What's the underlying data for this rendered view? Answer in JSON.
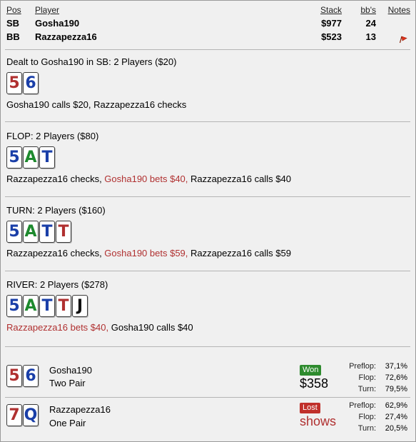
{
  "header": {
    "pos": "Pos",
    "player": "Player",
    "stack": "Stack",
    "bbs": "bb's",
    "notes": "Notes"
  },
  "players": [
    {
      "pos": "SB",
      "name": "Gosha190",
      "stack": "$977",
      "bbs": "24",
      "note_flag": false
    },
    {
      "pos": "BB",
      "name": "Razzapezza16",
      "stack": "$523",
      "bbs": "13",
      "note_flag": true
    }
  ],
  "colors": {
    "hearts_diamonds": "#b03030",
    "clubs": "#1e8a2e",
    "spades": "#111111",
    "blue": "#1a3fa8",
    "highlight": "#b03030",
    "won": "#2e8b2e",
    "lost": "#c0302b"
  },
  "preflop": {
    "title": "Dealt to Gosha190 in SB: 2 Players ($20)",
    "cards": [
      {
        "rank": "5",
        "color": "#b03030"
      },
      {
        "rank": "6",
        "color": "#1a3fa8"
      }
    ],
    "actions_a": "Gosha190 calls $20, Razzapezza16 checks"
  },
  "flop": {
    "title": "FLOP: 2 Players ($80)",
    "cards": [
      {
        "rank": "5",
        "color": "#1a3fa8"
      },
      {
        "rank": "A",
        "color": "#1e8a2e"
      },
      {
        "rank": "T",
        "color": "#1a3fa8"
      }
    ],
    "actions_a": "Razzapezza16 checks, ",
    "actions_b": "Gosha190 bets $40,",
    "actions_c": " Razzapezza16 calls $40"
  },
  "turn": {
    "title": "TURN: 2 Players ($160)",
    "cards": [
      {
        "rank": "5",
        "color": "#1a3fa8"
      },
      {
        "rank": "A",
        "color": "#1e8a2e"
      },
      {
        "rank": "T",
        "color": "#1a3fa8"
      },
      {
        "rank": "T",
        "color": "#b03030"
      }
    ],
    "actions_a": "Razzapezza16 checks, ",
    "actions_b": "Gosha190 bets $59,",
    "actions_c": " Razzapezza16 calls $59"
  },
  "river": {
    "title": "RIVER: 2 Players ($278)",
    "cards": [
      {
        "rank": "5",
        "color": "#1a3fa8"
      },
      {
        "rank": "A",
        "color": "#1e8a2e"
      },
      {
        "rank": "T",
        "color": "#1a3fa8"
      },
      {
        "rank": "T",
        "color": "#b03030"
      },
      {
        "rank": "J",
        "color": "#111111"
      }
    ],
    "actions_a": "Razzapezza16 bets $40,",
    "actions_b": " Gosha190 calls $40"
  },
  "results": [
    {
      "cards": [
        {
          "rank": "5",
          "color": "#b03030"
        },
        {
          "rank": "6",
          "color": "#1a3fa8"
        }
      ],
      "name": "Gosha190",
      "hand": "Two Pair",
      "badge": "Won",
      "amount": "$358",
      "stats": [
        {
          "label": "Preflop:",
          "value": "37,1%"
        },
        {
          "label": "Flop:",
          "value": "72,6%"
        },
        {
          "label": "Turn:",
          "value": "79,5%"
        }
      ]
    },
    {
      "cards": [
        {
          "rank": "7",
          "color": "#b03030"
        },
        {
          "rank": "Q",
          "color": "#1a3fa8"
        }
      ],
      "name": "Razzapezza16",
      "hand": "One Pair",
      "badge": "Lost",
      "amount": "shows",
      "stats": [
        {
          "label": "Preflop:",
          "value": "62,9%"
        },
        {
          "label": "Flop:",
          "value": "27,4%"
        },
        {
          "label": "Turn:",
          "value": "20,5%"
        }
      ]
    }
  ]
}
